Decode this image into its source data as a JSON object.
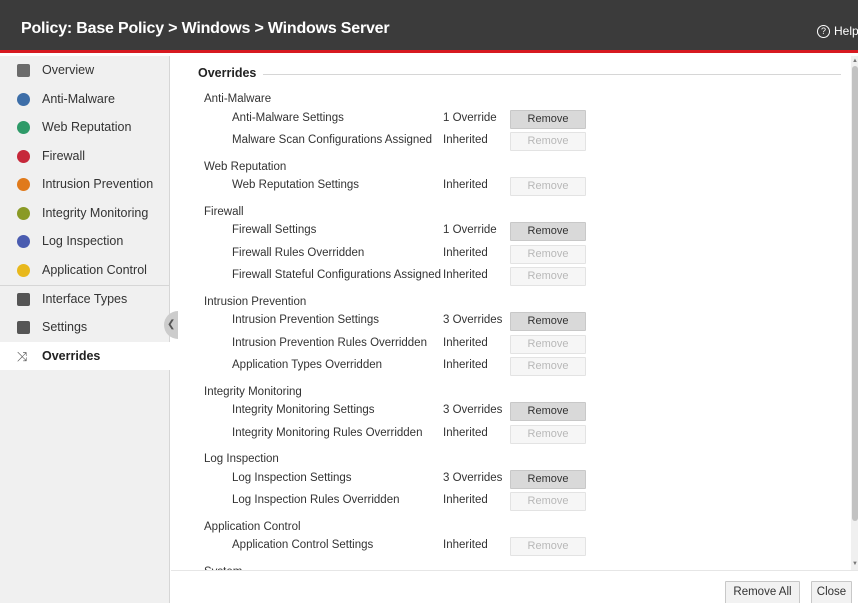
{
  "header": {
    "title": "Policy: Base Policy > Windows > Windows Server",
    "help_label": "Help"
  },
  "sidebar": {
    "items": [
      {
        "label": "Overview",
        "icon": "overview-icon",
        "color": "#6b6b6b"
      },
      {
        "label": "Anti-Malware",
        "icon": "anti-malware-icon",
        "color": "#3d6ea8"
      },
      {
        "label": "Web Reputation",
        "icon": "web-reputation-icon",
        "color": "#2e9a68"
      },
      {
        "label": "Firewall",
        "icon": "firewall-icon",
        "color": "#c6283a"
      },
      {
        "label": "Intrusion Prevention",
        "icon": "intrusion-prevention-icon",
        "color": "#e07a1b"
      },
      {
        "label": "Integrity Monitoring",
        "icon": "integrity-monitoring-icon",
        "color": "#8a9a25"
      },
      {
        "label": "Log Inspection",
        "icon": "log-inspection-icon",
        "color": "#4a5cb0"
      },
      {
        "label": "Application Control",
        "icon": "application-control-icon",
        "color": "#e8b81c"
      },
      {
        "label": "Interface Types",
        "icon": "interface-types-icon",
        "color": "#555555"
      },
      {
        "label": "Settings",
        "icon": "settings-gear-icon",
        "color": "#555555"
      },
      {
        "label": "Overrides",
        "icon": "overrides-icon",
        "color": "#555555",
        "active": true
      }
    ]
  },
  "overrides": {
    "section_title": "Overrides",
    "groups": [
      {
        "label": "Anti-Malware",
        "rows": [
          {
            "label": "Anti-Malware Settings",
            "status": "1 Override",
            "button": "Remove",
            "enabled": true
          },
          {
            "label": "Malware Scan Configurations Assigned",
            "status": "Inherited",
            "button": "Remove",
            "enabled": false
          }
        ]
      },
      {
        "label": "Web Reputation",
        "rows": [
          {
            "label": "Web Reputation Settings",
            "status": "Inherited",
            "button": "Remove",
            "enabled": false
          }
        ]
      },
      {
        "label": "Firewall",
        "rows": [
          {
            "label": "Firewall Settings",
            "status": "1 Override",
            "button": "Remove",
            "enabled": true
          },
          {
            "label": "Firewall Rules Overridden",
            "status": "Inherited",
            "button": "Remove",
            "enabled": false
          },
          {
            "label": "Firewall Stateful Configurations Assigned",
            "status": "Inherited",
            "button": "Remove",
            "enabled": false
          }
        ]
      },
      {
        "label": "Intrusion Prevention",
        "rows": [
          {
            "label": "Intrusion Prevention Settings",
            "status": "3 Overrides",
            "button": "Remove",
            "enabled": true
          },
          {
            "label": "Intrusion Prevention Rules Overridden",
            "status": "Inherited",
            "button": "Remove",
            "enabled": false
          },
          {
            "label": "Application Types Overridden",
            "status": "Inherited",
            "button": "Remove",
            "enabled": false
          }
        ]
      },
      {
        "label": "Integrity Monitoring",
        "rows": [
          {
            "label": "Integrity Monitoring Settings",
            "status": "3 Overrides",
            "button": "Remove",
            "enabled": true
          },
          {
            "label": "Integrity Monitoring Rules Overridden",
            "status": "Inherited",
            "button": "Remove",
            "enabled": false
          }
        ]
      },
      {
        "label": "Log Inspection",
        "rows": [
          {
            "label": "Log Inspection Settings",
            "status": "3 Overrides",
            "button": "Remove",
            "enabled": true
          },
          {
            "label": "Log Inspection Rules Overridden",
            "status": "Inherited",
            "button": "Remove",
            "enabled": false
          }
        ]
      },
      {
        "label": "Application Control",
        "rows": [
          {
            "label": "Application Control Settings",
            "status": "Inherited",
            "button": "Remove",
            "enabled": false
          }
        ]
      },
      {
        "label": "System",
        "rows": []
      }
    ]
  },
  "footer": {
    "remove_all_label": "Remove All",
    "close_label": "Close"
  },
  "colors": {
    "header_bg": "#3b3b3b",
    "accent": "#d71920"
  }
}
